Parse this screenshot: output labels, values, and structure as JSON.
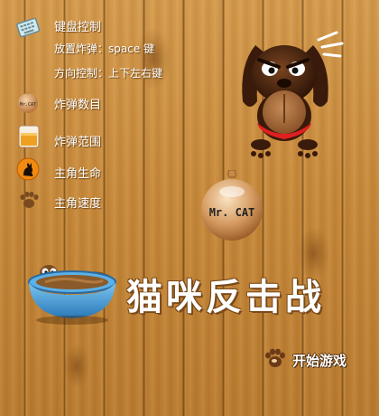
{
  "legend": {
    "keyboard_label": "键盘控制",
    "bomb_key_label": "放置炸弹：space 键",
    "direction_label": "方向控制：上下左右键",
    "bomb_count_label": "炸弹数目",
    "bomb_range_label": "炸弹范围",
    "lives_label": "主角生命",
    "speed_label": "主角速度"
  },
  "title": "猫咪反击战",
  "medallion_text": "Mr. CAT",
  "mini_badge_text": "Mr.CAT",
  "start_button": {
    "label": "开始游戏",
    "icon": "paw-icon"
  },
  "colors": {
    "wood": "#c68a3c",
    "dog_dark": "#4a2510",
    "dog_muzzle": "#a06a3a",
    "collar": "#e02020",
    "bowl": "#4aa6e0"
  }
}
